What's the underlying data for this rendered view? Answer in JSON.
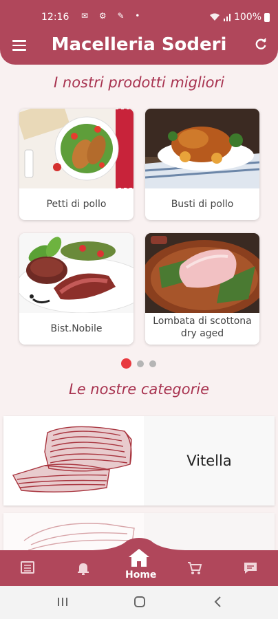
{
  "status_bar": {
    "time": "12:16",
    "battery": "100%"
  },
  "app_bar": {
    "title": "Macelleria Soderi"
  },
  "featured": {
    "title": "I nostri prodotti migliori",
    "products": [
      {
        "label": "Petti di pollo"
      },
      {
        "label": "Busti di pollo"
      },
      {
        "label": "Bist.Nobile"
      },
      {
        "label": "Lombata di scottona dry aged"
      }
    ],
    "pagination": {
      "pages": 3,
      "active": 1
    }
  },
  "categories": {
    "title": "Le nostre categorie",
    "items": [
      {
        "label": "Vitella"
      }
    ]
  },
  "bottom_nav": {
    "home_label": "Home"
  },
  "colors": {
    "primary": "#b0475b",
    "accent": "#e8393f",
    "title": "#a83350"
  }
}
